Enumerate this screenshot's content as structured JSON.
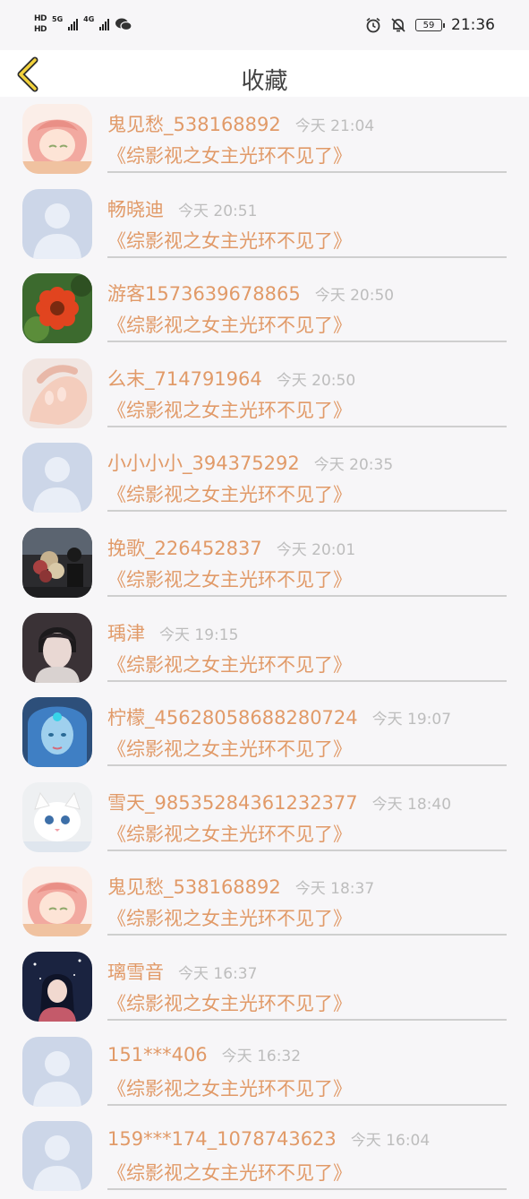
{
  "status_bar": {
    "sim1": "HD",
    "sim2": "HD",
    "net1": "5G",
    "net2": "4G",
    "battery": "59",
    "time": "21:36"
  },
  "header": {
    "title": "收藏"
  },
  "items": [
    {
      "name": "鬼见愁_538168892",
      "time": "今天 21:04",
      "book": "《综影视之女主光环不见了》",
      "avatar": "girl-anime-pink"
    },
    {
      "name": "畅晓迪",
      "time": "今天 20:51",
      "book": "《综影视之女主光环不见了》",
      "avatar": "default"
    },
    {
      "name": "游客1573639678865",
      "time": "今天 20:50",
      "book": "《综影视之女主光环不见了》",
      "avatar": "flower"
    },
    {
      "name": "么末_714791964",
      "time": "今天 20:50",
      "book": "《综影视之女主光环不见了》",
      "avatar": "hands"
    },
    {
      "name": "小小小小_394375292",
      "time": "今天 20:35",
      "book": "《综影视之女主光环不见了》",
      "avatar": "default"
    },
    {
      "name": "挽歌_226452837",
      "time": "今天 20:01",
      "book": "《综影视之女主光环不见了》",
      "avatar": "bouquet"
    },
    {
      "name": "瑀津",
      "time": "今天 19:15",
      "book": "《综影视之女主光环不见了》",
      "avatar": "boy"
    },
    {
      "name": "柠檬_45628058688280724",
      "time": "今天 19:07",
      "book": "《综影视之女主光环不见了》",
      "avatar": "blue-girl"
    },
    {
      "name": "雪天_98535284361232377",
      "time": "今天 18:40",
      "book": "《综影视之女主光环不见了》",
      "avatar": "kitten"
    },
    {
      "name": "鬼见愁_538168892",
      "time": "今天 18:37",
      "book": "《综影视之女主光环不见了》",
      "avatar": "girl-anime-pink"
    },
    {
      "name": "璃雪音",
      "time": "今天 16:37",
      "book": "《综影视之女主光环不见了》",
      "avatar": "night-girl"
    },
    {
      "name": "151***406",
      "time": "今天 16:32",
      "book": "《综影视之女主光环不见了》",
      "avatar": "default"
    },
    {
      "name": "159***174_1078743623",
      "time": "今天 16:04",
      "book": "《综影视之女主光环不见了》",
      "avatar": "default"
    }
  ]
}
